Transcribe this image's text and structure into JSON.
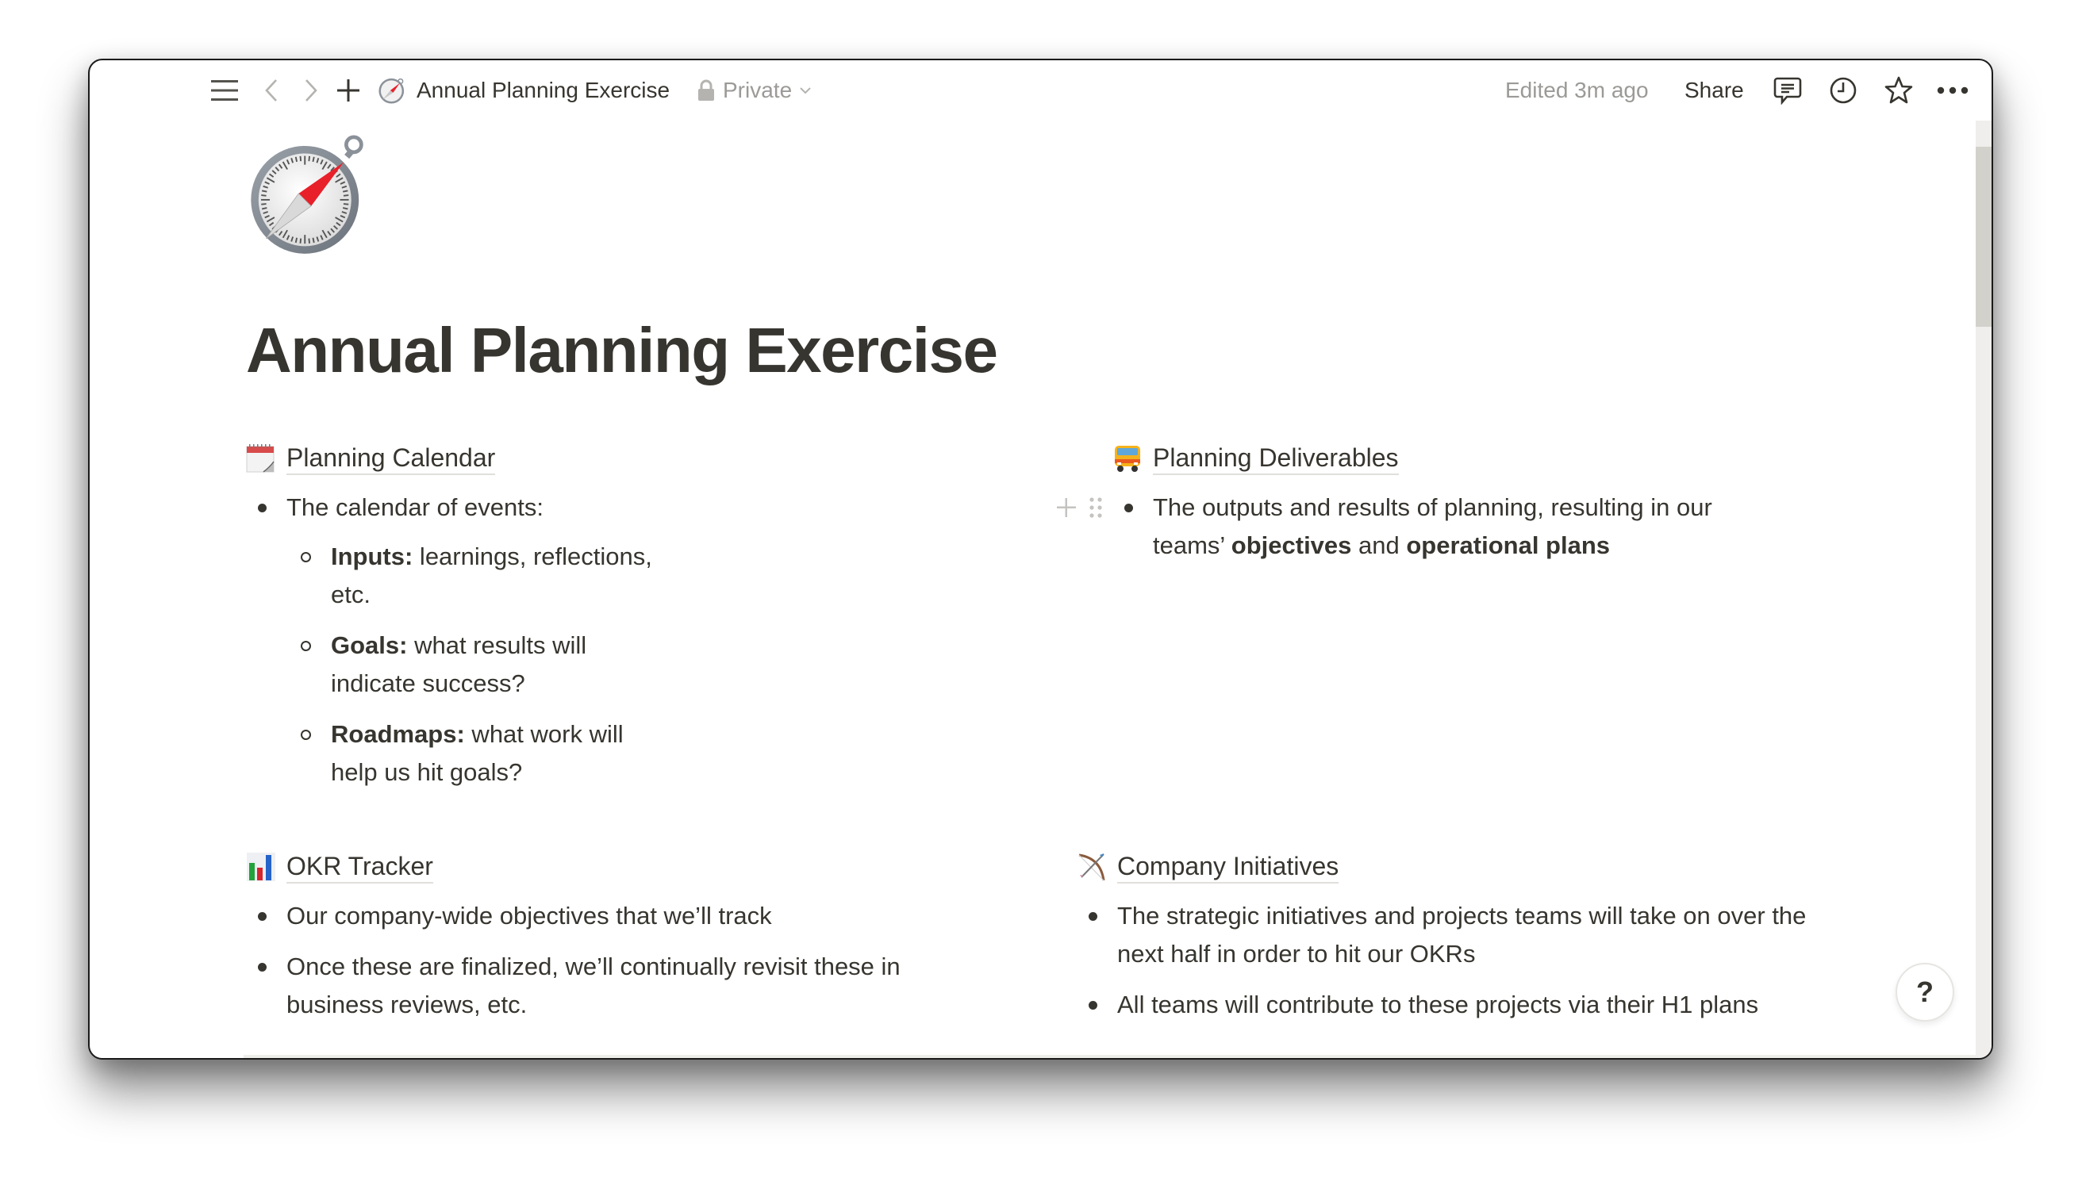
{
  "topbar": {
    "icons": {
      "menu": "hamburger-menu-icon",
      "back": "chevron-left-icon",
      "forward": "chevron-right-icon",
      "new": "plus-icon",
      "page": "compass-emoji-icon",
      "lock": "lock-icon",
      "privacy_caret": "chevron-down-icon",
      "comments": "comment-icon",
      "updates": "clock-icon",
      "favorite": "star-icon",
      "more": "more-horizontal-icon"
    },
    "breadcrumb_title": "Annual Planning Exercise",
    "privacy_label": "Private",
    "edited_label": "Edited 3m ago",
    "share_label": "Share"
  },
  "page": {
    "icon": "compass-emoji",
    "title": "Annual Planning Exercise",
    "sections": [
      {
        "emoji": "calendar-emoji",
        "title": "Planning Calendar",
        "bullets": [
          {
            "text": "The calendar of events:",
            "children": [
              {
                "bold": "Inputs:",
                "text": " learnings, reflections, etc."
              },
              {
                "bold": "Goals:",
                "text": " what results will indicate success?"
              },
              {
                "bold": "Roadmaps:",
                "text": " what work will help us hit goals?"
              }
            ]
          }
        ]
      },
      {
        "emoji": "bus-emoji",
        "title": "Planning Deliverables",
        "bullets": [
          {
            "parts": [
              {
                "text": "The outputs and results of planning, resulting in our teams’ ",
                "bold": false
              },
              {
                "text": "objectives",
                "bold": true
              },
              {
                "text": " and ",
                "bold": false
              },
              {
                "text": "operational plans",
                "bold": true
              }
            ]
          }
        ]
      },
      {
        "emoji": "bar-chart-emoji",
        "title": "OKR Tracker",
        "bullets": [
          {
            "text": "Our company-wide objectives that we’ll track"
          },
          {
            "text": "Once these are finalized, we’ll continually revisit these in business reviews, etc."
          }
        ]
      },
      {
        "emoji": "bow-and-arrow-emoji",
        "title": "Company Initiatives",
        "bullets": [
          {
            "text": "The strategic initiatives and projects teams will take on over the next half in order to hit our OKRs"
          },
          {
            "text": "All teams will contribute to these projects via their H1 plans"
          }
        ]
      }
    ],
    "block_handles": {
      "add": "plus-icon",
      "drag": "drag-handle-icon"
    }
  },
  "help": {
    "label": "?"
  }
}
